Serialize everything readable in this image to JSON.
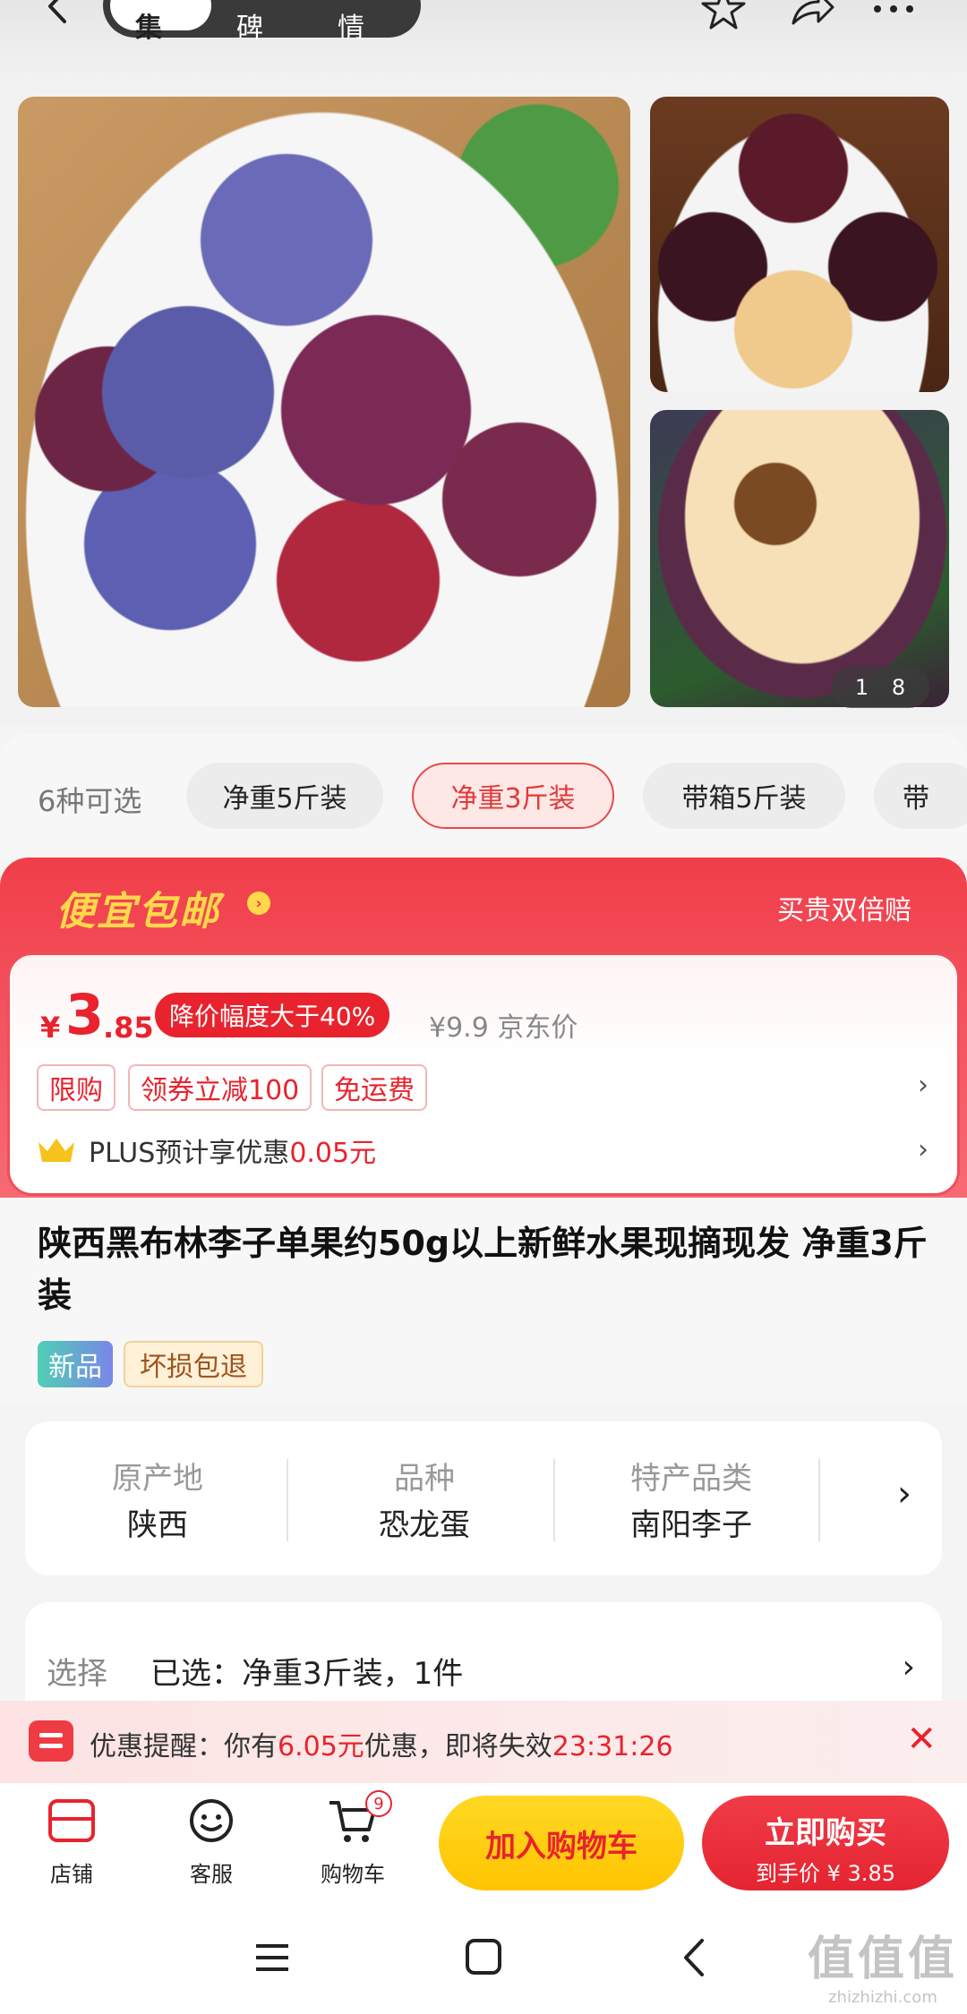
{
  "header": {
    "tabs": [
      {
        "label": "图集",
        "active": true
      },
      {
        "label": "口碑",
        "active": false
      },
      {
        "label": "详情",
        "active": false
      }
    ],
    "icons": [
      "back-icon",
      "star-icon",
      "share-icon",
      "more-icon"
    ]
  },
  "gallery": {
    "current": "1",
    "total": "8"
  },
  "options": {
    "count_label": "6种可选",
    "items": [
      "净重5斤装",
      "净重3斤装",
      "带箱5斤装",
      "带"
    ],
    "selected_index": 1
  },
  "promo": {
    "title": "便宜包邮",
    "right_text": "买贵双倍赔",
    "currency": "¥",
    "price_int": "3",
    "price_dec": ".85",
    "discount_badge": "降价幅度大于40%",
    "jd_price": "¥9.9 京东价",
    "tags": [
      "限购",
      "领券立减100",
      "免运费"
    ],
    "plus_prefix": "PLUS预计享优惠",
    "plus_amount": "0.05元"
  },
  "product": {
    "title": "陕西黑布林李子单果约50g以上新鲜水果现摘现发 净重3斤装",
    "badges": [
      "新品",
      "坏损包退"
    ]
  },
  "attributes": [
    {
      "label": "原产地",
      "value": "陕西"
    },
    {
      "label": "品种",
      "value": "恐龙蛋"
    },
    {
      "label": "特产品类",
      "value": "南阳李子"
    }
  ],
  "selection": {
    "label": "选择",
    "value": "已选：净重3斤装，1件"
  },
  "reminder": {
    "prefix": "优惠提醒：你有",
    "amount": "6.05元",
    "middle": "优惠，即将失效",
    "countdown": "23:31:26"
  },
  "bottom_bar": {
    "store": "店铺",
    "service": "客服",
    "cart": "购物车",
    "cart_count": "9",
    "add_to_cart": "加入购物车",
    "buy_now": "立即购买",
    "buy_price": "到手价 ¥ 3.85"
  },
  "watermark": {
    "big": "值值值",
    "small": "zhizhizhi.com"
  },
  "colors": {
    "accent_red": "#e8232d",
    "promo_yellow": "#ffd84b",
    "cart_button": "#ffc400"
  }
}
